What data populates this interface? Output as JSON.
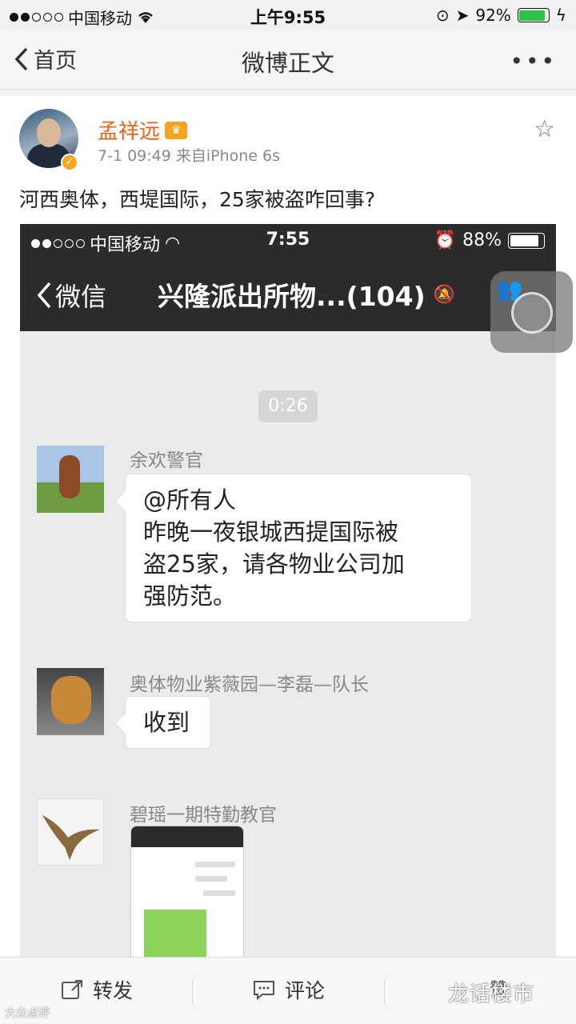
{
  "status_bar": {
    "carrier": "中国移动",
    "time": "上午9:55",
    "battery": "92%",
    "battery_level": 0.92
  },
  "nav": {
    "back_label": "首页",
    "title": "微博正文",
    "more": "•••"
  },
  "post": {
    "username": "孟祥远",
    "time": "7-1 09:49",
    "source": "来自iPhone 6s",
    "text": "河西奥体，西堤国际，25家被盗咋回事?"
  },
  "embedded": {
    "status_bar": {
      "carrier": "中国移动",
      "time": "7:55",
      "battery": "88%",
      "battery_level": 0.88
    },
    "nav": {
      "back_label": "微信",
      "title": "兴隆派出所物...(104)"
    },
    "time_pill": "0:26",
    "messages": [
      {
        "sender": "余欢警官",
        "lines": [
          "@所有人",
          "昨晚一夜银城西提国际被",
          "盗25家，请各物业公司加",
          "强防范。"
        ]
      },
      {
        "sender": "奥体物业紫薇园—李磊—队长",
        "lines": [
          "收到"
        ]
      },
      {
        "sender": "碧瑶一期特勤教官",
        "lines": []
      }
    ]
  },
  "bottom_bar": {
    "repost": "转发",
    "comment": "评论",
    "like": "赞"
  },
  "watermark": {
    "main": "龙话楼市",
    "corner": "大众点评"
  }
}
